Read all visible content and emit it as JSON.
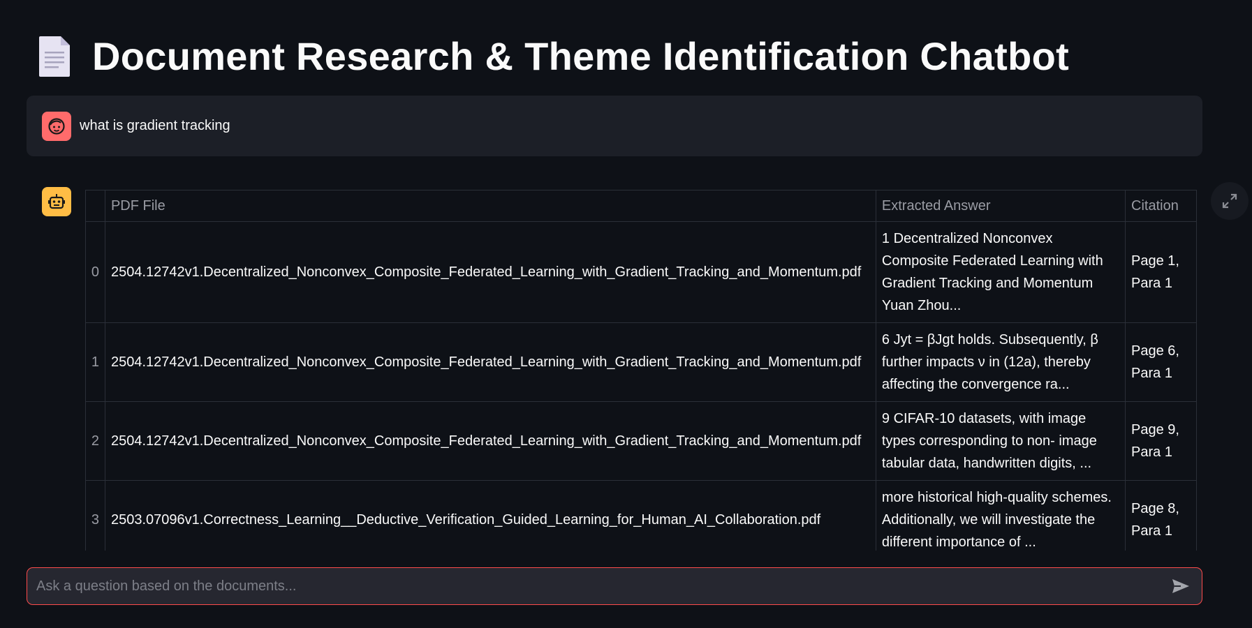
{
  "header": {
    "title": "Document Research & Theme Identification Chatbot",
    "icon": "document-icon"
  },
  "user_message": {
    "avatar_icon": "user-face-icon",
    "text": "what is gradient tracking"
  },
  "assistant": {
    "avatar_icon": "robot-icon",
    "table": {
      "columns": [
        "",
        "PDF File",
        "Extracted Answer",
        "Citation"
      ],
      "rows": [
        {
          "index": "0",
          "pdf": "2504.12742v1.Decentralized_Nonconvex_Composite_Federated_Learning_with_Gradient_Tracking_and_Momentum.pdf",
          "answer": "1 Decentralized Nonconvex Composite Federated Learning with Gradient Tracking and Momentum Yuan Zhou...",
          "citation": "Page 1, Para 1"
        },
        {
          "index": "1",
          "pdf": "2504.12742v1.Decentralized_Nonconvex_Composite_Federated_Learning_with_Gradient_Tracking_and_Momentum.pdf",
          "answer": "6 Jyt = βJgt holds. Subsequently, β further impacts ν in (12a), thereby affecting the convergence ra...",
          "citation": "Page 6, Para 1"
        },
        {
          "index": "2",
          "pdf": "2504.12742v1.Decentralized_Nonconvex_Composite_Federated_Learning_with_Gradient_Tracking_and_Momentum.pdf",
          "answer": "9 CIFAR-10 datasets, with image types corresponding to non- image tabular data, handwritten digits, ...",
          "citation": "Page 9, Para 1"
        },
        {
          "index": "3",
          "pdf": "2503.07096v1.Correctness_Learning__Deductive_Verification_Guided_Learning_for_Human_AI_Collaboration.pdf",
          "answer": "more historical high-quality schemes. Additionally, we will investigate the different importance of ...",
          "citation": "Page 8, Para 1"
        }
      ]
    }
  },
  "chat_input": {
    "placeholder": "Ask a question based on the documents..."
  },
  "colors": {
    "background": "#0e1117",
    "message_bg": "#1c1f27",
    "user_avatar": "#ff6b6b",
    "bot_avatar": "#ffbd45",
    "input_border": "#ff4b4b"
  }
}
